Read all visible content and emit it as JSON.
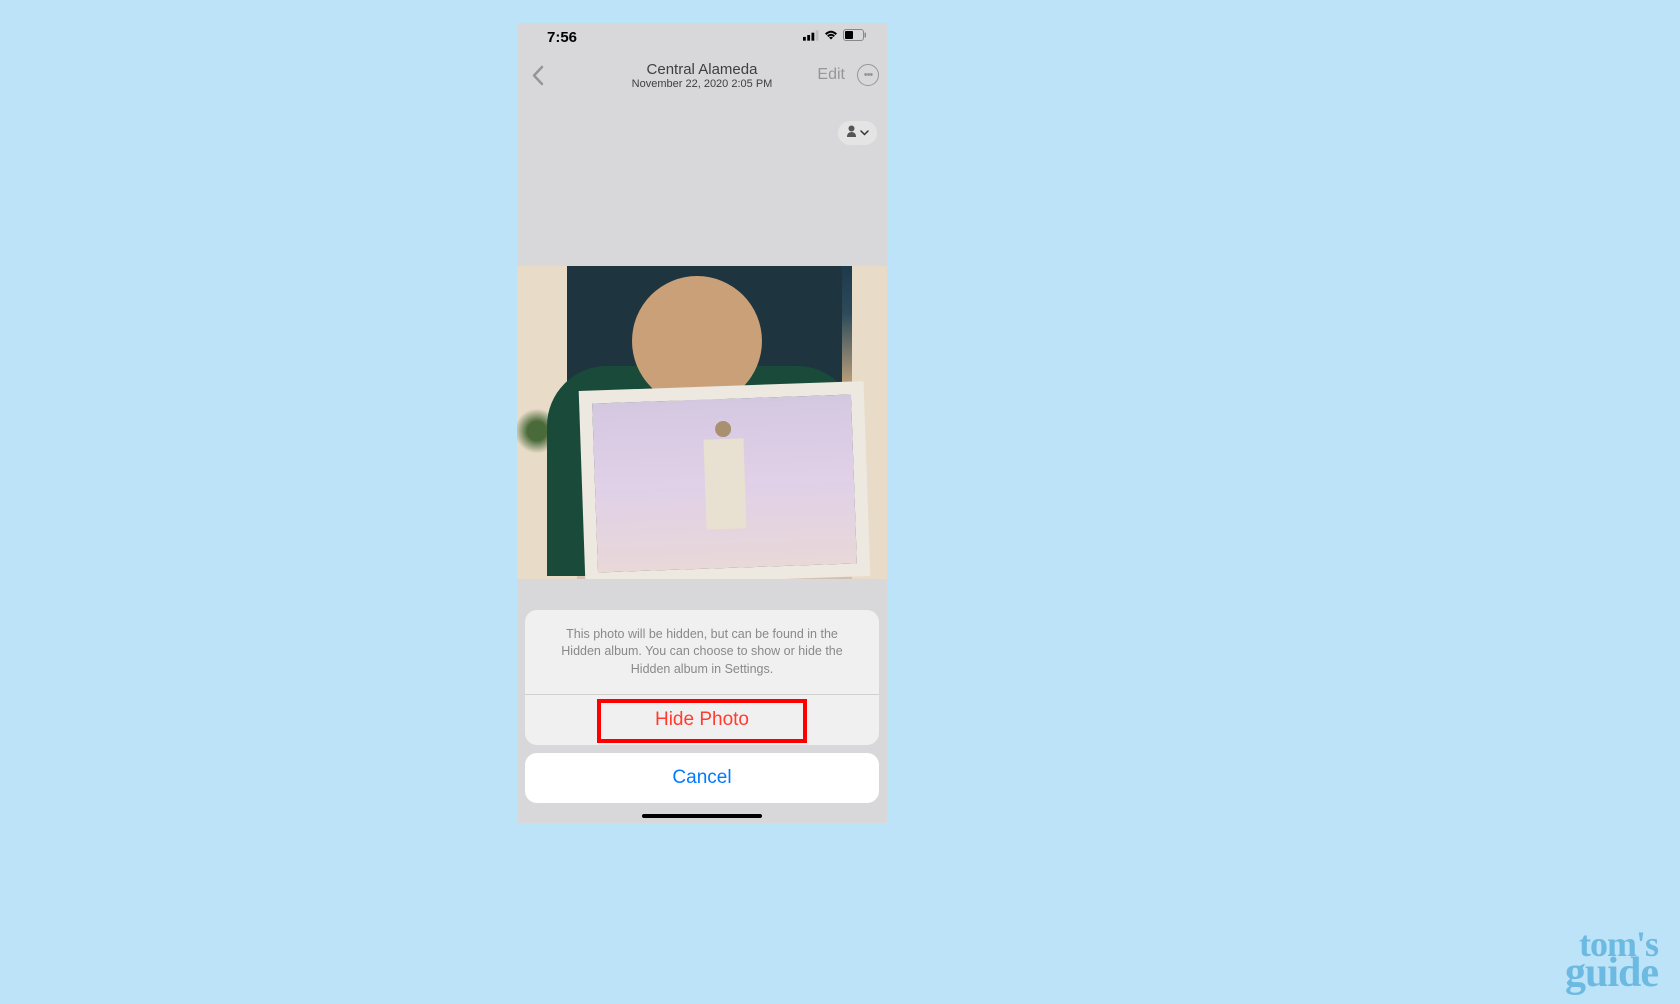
{
  "status_bar": {
    "time": "7:56"
  },
  "nav": {
    "location_title": "Central Alameda",
    "date_subtitle": "November 22, 2020  2:05 PM",
    "edit_label": "Edit"
  },
  "action_sheet": {
    "message": "This photo will be hidden, but can be found in the Hidden album. You can choose to show or hide the Hidden album in Settings.",
    "hide_label": "Hide Photo",
    "cancel_label": "Cancel"
  },
  "watermark": {
    "line1": "tom's",
    "line2": "guide"
  }
}
